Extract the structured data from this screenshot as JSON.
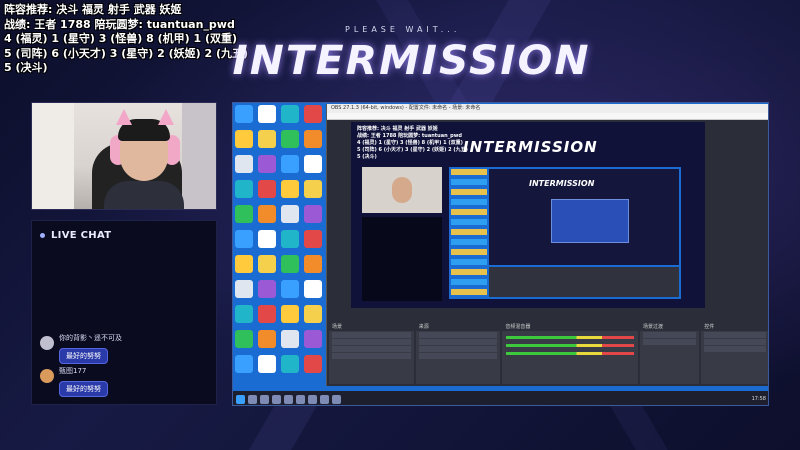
{
  "overlay": {
    "line1": "阵容推荐: 决斗 福灵 射手 武器 妖姬",
    "line2": "战绩: 王者 1788 陪玩圆梦: tuantuan_pwd",
    "line3": "4 (福灵) 1 (星守) 3 (怪兽) 8 (机甲) 1 (双重)",
    "line4": "5 (司阵) 6 (小天才) 3 (星守) 2 (妖姬) 2 (九五)",
    "line5": "5 (决斗)"
  },
  "title": {
    "pre": "PLEASE WAIT...",
    "main": "INTERMISSION"
  },
  "chat": {
    "header": "LIVE CHAT",
    "messages": [
      {
        "user": "你的背影丶遥不可及",
        "text": "最好的努努"
      },
      {
        "user": "甄图177",
        "text": "最好的努努"
      }
    ]
  },
  "screen": {
    "obs_title": "OBS 27.1.3 (64-bit, windows) - 配置文件: 未命名 - 场景: 未命名",
    "preview_title": "INTERMISSION",
    "panels": [
      "场景",
      "来源",
      "音频混音器",
      "场景过渡",
      "控件"
    ],
    "taskbar_time": "17:58"
  },
  "colors": {
    "background": "#0b0c22",
    "accent": "#2a3aa8",
    "desktop": "#1a6bd2"
  }
}
